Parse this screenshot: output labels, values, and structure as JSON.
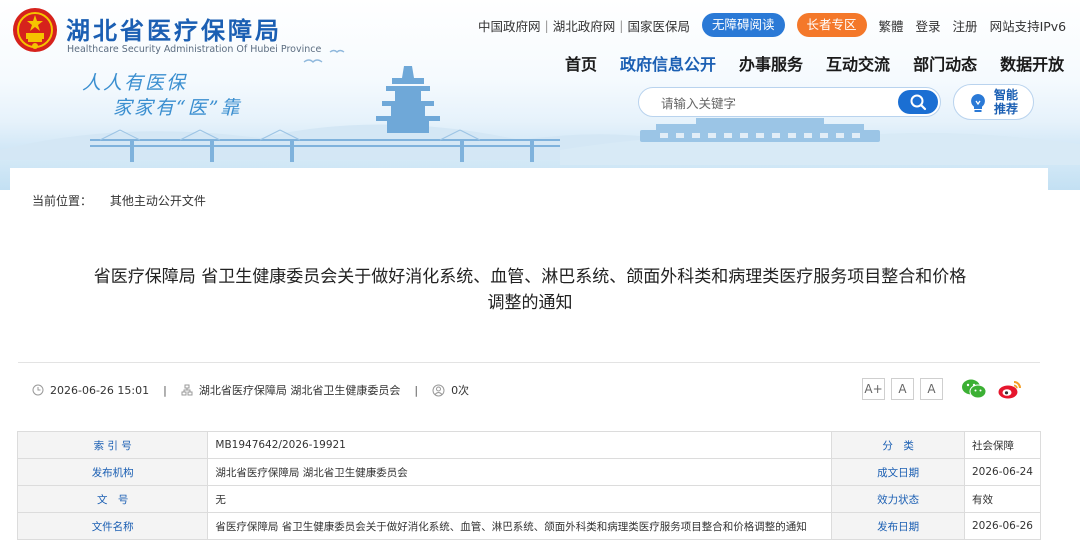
{
  "site": {
    "name_cn": "湖北省医疗保障局",
    "name_en": "Healthcare Security Administration Of Hubei Province",
    "slogan_line1": "人人有医保",
    "slogan_line2": "家家有“医”靠"
  },
  "toplinks": {
    "gov_cn": "中国政府网",
    "hubei_gov": "湖北政府网",
    "nhsa": "国家医保局",
    "accessible": "无障碍阅读",
    "elder": "长者专区",
    "traditional": "繁體",
    "login": "登录",
    "register": "注册",
    "ipv6": "网站支持IPv6"
  },
  "nav": [
    {
      "label": "首页"
    },
    {
      "label": "政府信息公开"
    },
    {
      "label": "办事服务"
    },
    {
      "label": "互动交流"
    },
    {
      "label": "部门动态"
    },
    {
      "label": "数据开放"
    }
  ],
  "search": {
    "placeholder": "请输入关键字"
  },
  "smart_recommend": {
    "line1": "智能",
    "line2": "推荐"
  },
  "breadcrumb": {
    "prefix": "当前位置：",
    "current": "其他主动公开文件"
  },
  "article": {
    "title_line1": "省医疗保障局 省卫生健康委员会关于做好消化系统、血管、淋巴系统、颌面外科类和病理类医疗服务项目整合和价格",
    "title_line2": "调整的通知",
    "date": "2026-06-26 15:01",
    "source": "湖北省医疗保障局 湖北省卫生健康委员会",
    "views": "0次"
  },
  "font_size_buttons": {
    "increase": "A+",
    "normal": "A",
    "default": "A"
  },
  "info_table": {
    "rows": [
      {
        "label1": "索 引 号",
        "value1": "MB1947642/2026-19921",
        "label2": "分　类",
        "value2": "社会保障"
      },
      {
        "label1": "发布机构",
        "value1": "湖北省医疗保障局 湖北省卫生健康委员会",
        "label2": "成文日期",
        "value2": "2026-06-24"
      },
      {
        "label1": "文　号",
        "value1": "无",
        "label2": "效力状态",
        "value2": "有效"
      },
      {
        "label1": "文件名称",
        "value1": "省医疗保障局 省卫生健康委员会关于做好消化系统、血管、淋巴系统、颌面外科类和病理类医疗服务项目整合和价格调整的通知",
        "label2": "发布日期",
        "value2": "2026-06-26"
      }
    ]
  },
  "colors": {
    "brand_blue": "#1b5fb3",
    "pill_blue": "#2a79d6",
    "pill_orange": "#f4782a",
    "search_button": "#1b6fd3"
  }
}
